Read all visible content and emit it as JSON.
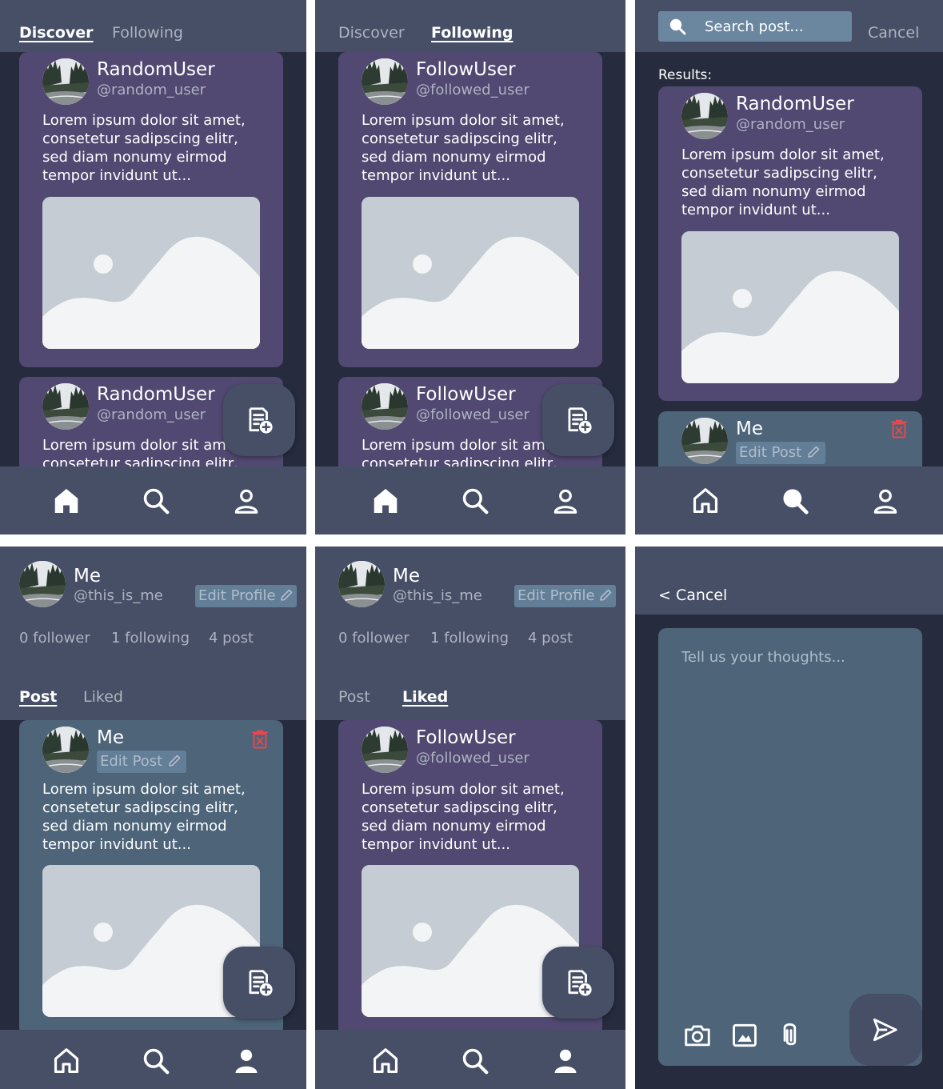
{
  "colors": {
    "background": "#262c3e",
    "bar": "#474f66",
    "card_purple": "#514971",
    "card_teal": "#4d6479",
    "delete_red": "#e5484d"
  },
  "users": {
    "random": {
      "name": "RandomUser",
      "handle": "@random_user"
    },
    "follow": {
      "name": "FollowUser",
      "handle": "@followed_user"
    },
    "me": {
      "name": "Me",
      "handle": "@this_is_me"
    }
  },
  "post_body": "Lorem ipsum dolor sit amet, consetetur sadipscing elitr, sed diam nonumy eirmod tempor invidunt ut...",
  "feed_tabs": {
    "discover": "Discover",
    "following": "Following"
  },
  "search": {
    "placeholder": "Search post...",
    "cancel": "Cancel",
    "results_label": "Results:"
  },
  "post_actions": {
    "edit_post": "Edit Post"
  },
  "profile": {
    "edit_profile": "Edit Profile",
    "followers": "0 follower",
    "following": "1 following",
    "posts": "4 post",
    "tabs": {
      "post": "Post",
      "liked": "Liked"
    }
  },
  "composer": {
    "cancel": "< Cancel",
    "placeholder": "Tell us your thoughts..."
  },
  "icons": [
    "home-icon",
    "search-icon",
    "person-icon",
    "new-post-icon",
    "trash-icon",
    "pencil-icon",
    "camera-icon",
    "image-icon",
    "paperclip-icon",
    "send-icon"
  ]
}
